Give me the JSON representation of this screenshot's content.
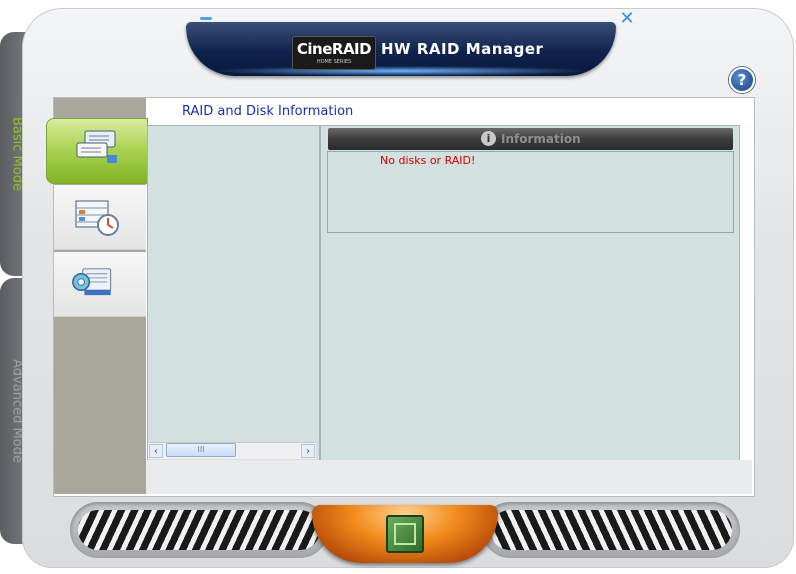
{
  "window": {
    "brand_logo_text": "CineRAID",
    "brand_logo_subtext": "HOME SERIES",
    "title": "HW RAID Manager",
    "minimize_label": "minimize",
    "close_label": "close",
    "help_symbol": "?"
  },
  "side_tabs": [
    {
      "label": "Basic Mode",
      "active": true,
      "color": "#8ec31f"
    },
    {
      "label": "Advanced Mode",
      "active": false,
      "color": "#9da0a3"
    }
  ],
  "nav": {
    "buttons": [
      {
        "icon": "raid-disk-info-icon",
        "active": true
      },
      {
        "icon": "raid-schedule-icon",
        "active": false
      },
      {
        "icon": "settings-icon",
        "active": false
      }
    ]
  },
  "main": {
    "section_title": "RAID and Disk Information",
    "info_header": "Information",
    "info_icon_symbol": "i",
    "status_message": "No disks or RAID!"
  },
  "scrollbar": {
    "left_arrow": "‹",
    "right_arrow": "›",
    "thumb_grip": "III"
  },
  "colors": {
    "accent_green": "#8ec31f",
    "title_blue": "#1b2fb3",
    "error_red": "#d10000",
    "pane_bg": "#d2e0e0"
  }
}
